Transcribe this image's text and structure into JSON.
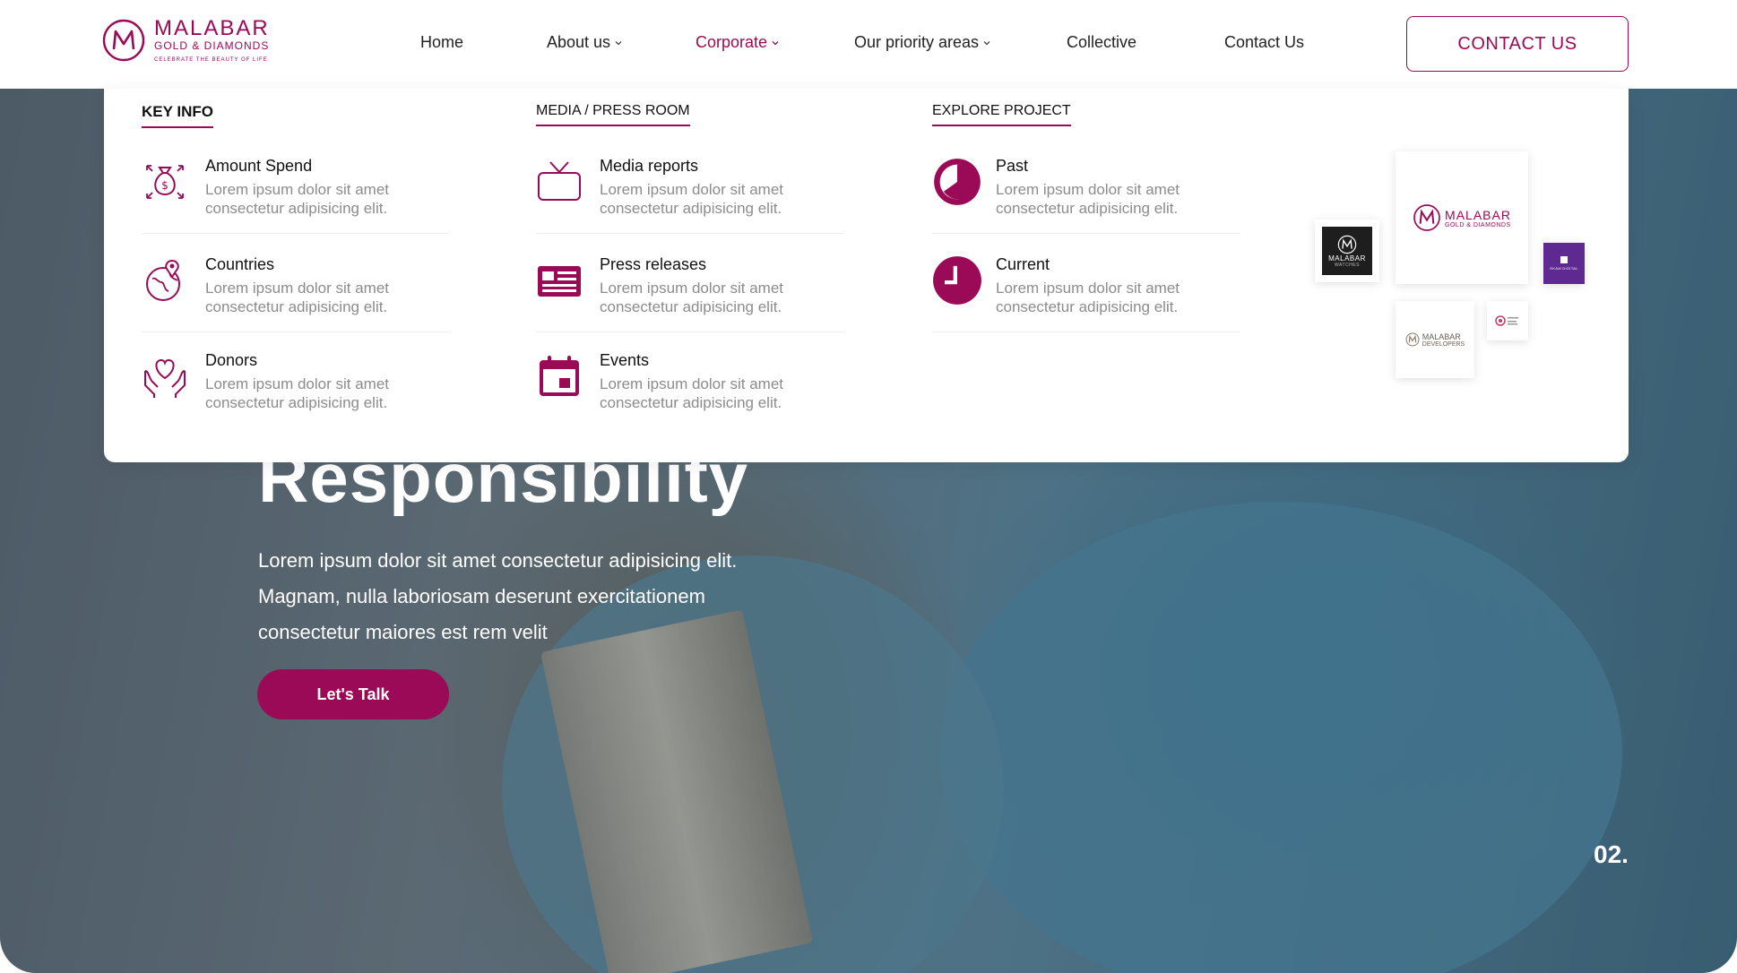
{
  "brand": {
    "name": "MALABAR",
    "sub": "GOLD & DIAMONDS",
    "tagline": "CELEBRATE THE BEAUTY OF LIFE",
    "accent": "#9a0a56"
  },
  "nav": {
    "items": [
      {
        "label": "Home",
        "has_dropdown": false
      },
      {
        "label": "About us",
        "has_dropdown": true
      },
      {
        "label": "Corporate",
        "has_dropdown": true,
        "active": true
      },
      {
        "label": "Our priority areas",
        "has_dropdown": true
      },
      {
        "label": "Collective",
        "has_dropdown": false
      },
      {
        "label": "Contact Us",
        "has_dropdown": false
      }
    ],
    "cta_label": "CONTACT US"
  },
  "mega_menu": {
    "columns": [
      {
        "heading": "KEY INFO",
        "items": [
          {
            "title": "Amount Spend",
            "desc_line1": "Lorem ipsum dolor sit amet",
            "desc_line2": "consectetur adipisicing elit.",
            "icon": "money-bag-icon"
          },
          {
            "title": "Countries",
            "desc_line1": "Lorem ipsum dolor sit amet",
            "desc_line2": "consectetur adipisicing elit.",
            "icon": "globe-pin-icon"
          },
          {
            "title": "Donors",
            "desc_line1": "Lorem ipsum dolor sit amet",
            "desc_line2": "consectetur adipisicing elit.",
            "icon": "heart-hands-icon"
          }
        ]
      },
      {
        "heading": "MEDIA / PRESS ROOM",
        "items": [
          {
            "title": "Media reports",
            "desc_line1": "Lorem ipsum dolor sit amet",
            "desc_line2": "consectetur adipisicing elit.",
            "icon": "tv-icon"
          },
          {
            "title": "Press releases",
            "desc_line1": "Lorem ipsum dolor sit amet",
            "desc_line2": "consectetur adipisicing elit.",
            "icon": "newspaper-icon"
          },
          {
            "title": "Events",
            "desc_line1": "Lorem ipsum dolor sit amet",
            "desc_line2": "consectetur adipisicing elit.",
            "icon": "calendar-icon"
          }
        ]
      },
      {
        "heading": "EXPLORE PROJECT",
        "items": [
          {
            "title": "Past",
            "desc_line1": "Lorem ipsum dolor sit amet",
            "desc_line2": "consectetur adipisicing elit.",
            "icon": "pie-clock-icon"
          },
          {
            "title": "Current",
            "desc_line1": "Lorem ipsum dolor sit amet",
            "desc_line2": "consectetur adipisicing elit.",
            "icon": "clock-icon"
          }
        ]
      }
    ],
    "brands": {
      "main_name": "MALABAR",
      "main_sub": "GOLD & DIAMONDS",
      "watches_name": "MALABAR",
      "watches_sub": "WATCHES",
      "developers_name": "MALABAR",
      "developers_sub": "DEVELOPERS",
      "digital_name": "EKAM DIGITAL"
    }
  },
  "hero": {
    "title": "Responsibility",
    "text_line1": "Lorem ipsum dolor sit amet consectetur adipisicing elit.",
    "text_line2": "Magnam, nulla laboriosam deserunt exercitationem",
    "text_line3": "consectetur maiores est rem velit",
    "cta_label": "Let's Talk",
    "slide_number": "02."
  }
}
